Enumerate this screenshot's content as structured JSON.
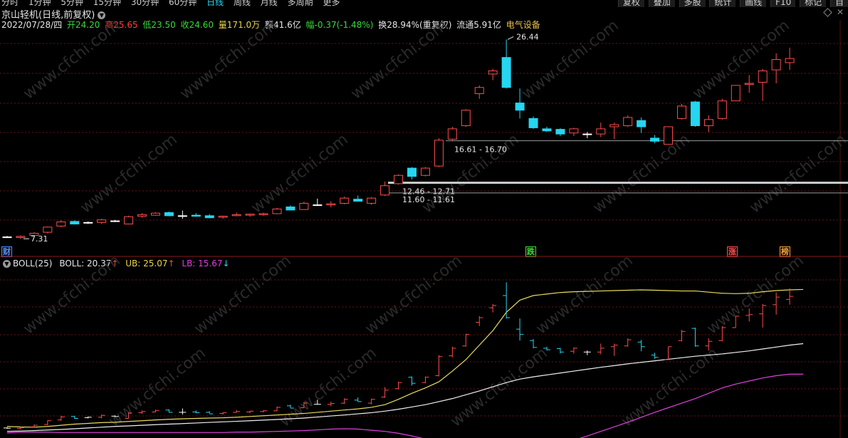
{
  "toolbar": {
    "periods": [
      "分时",
      "1分钟",
      "5分钟",
      "15分钟",
      "30分钟",
      "60分钟",
      "日线",
      "周线",
      "月线",
      "多周期",
      "更多"
    ],
    "active_period": "日线",
    "right_buttons": [
      "复权",
      "叠加",
      "多股",
      "统计",
      "画线",
      "F10",
      "标记",
      "自"
    ]
  },
  "stock": {
    "name": "京山轻机(日线,前复权)"
  },
  "quote": {
    "date": "2022/07/28/四",
    "open": "开24.20",
    "high": "高25.65",
    "low": "低23.50",
    "close": "收24.60",
    "volume": "量171.0万",
    "amount": "额41.6亿",
    "change": "幅-0.37(-1.48%)",
    "turnover": "换28.94%(重复权)",
    "float": "流通5.91亿",
    "sector": "电气设备"
  },
  "boll_panel": {
    "name": "BOLL(25)",
    "mid": "BOLL: 20.37",
    "ub": "UB: 25.07",
    "lb": "LB: 15.67"
  },
  "watermark": "www.cfchi.com",
  "colors": {
    "up": "#ff4b4b",
    "down": "#24d6f0",
    "doji": "#ffffff",
    "ub": "#e8dc5a",
    "mid": "#f0f0f0",
    "lb": "#e040e0",
    "grid": "#6b1010"
  },
  "chart_data": {
    "type": "candlestick",
    "ylim": [
      6.5,
      27.5
    ],
    "candles": [
      {
        "o": 7.35,
        "h": 7.45,
        "l": 7.25,
        "c": 7.32
      },
      {
        "o": 7.3,
        "h": 7.5,
        "l": 7.15,
        "c": 7.4
      },
      {
        "o": 7.5,
        "h": 7.8,
        "l": 7.4,
        "c": 7.7
      },
      {
        "o": 7.8,
        "h": 8.35,
        "l": 7.7,
        "c": 8.3
      },
      {
        "o": 8.4,
        "h": 8.95,
        "l": 8.3,
        "c": 8.8
      },
      {
        "o": 8.85,
        "h": 8.95,
        "l": 8.55,
        "c": 8.6
      },
      {
        "o": 8.7,
        "h": 8.85,
        "l": 8.6,
        "c": 8.75
      },
      {
        "o": 8.75,
        "h": 9.1,
        "l": 8.6,
        "c": 9.0
      },
      {
        "o": 8.9,
        "h": 9.0,
        "l": 8.8,
        "c": 8.85
      },
      {
        "o": 8.6,
        "h": 9.4,
        "l": 8.6,
        "c": 9.3
      },
      {
        "o": 9.35,
        "h": 9.65,
        "l": 9.2,
        "c": 9.5
      },
      {
        "o": 9.45,
        "h": 9.75,
        "l": 9.4,
        "c": 9.65
      },
      {
        "o": 9.7,
        "h": 9.8,
        "l": 9.35,
        "c": 9.4
      },
      {
        "o": 9.4,
        "h": 9.9,
        "l": 9.1,
        "c": 9.4
      },
      {
        "o": 9.45,
        "h": 9.65,
        "l": 9.3,
        "c": 9.35
      },
      {
        "o": 9.4,
        "h": 9.55,
        "l": 9.25,
        "c": 9.2
      },
      {
        "o": 9.25,
        "h": 9.4,
        "l": 9.1,
        "c": 9.35
      },
      {
        "o": 9.4,
        "h": 9.7,
        "l": 9.35,
        "c": 9.5
      },
      {
        "o": 9.45,
        "h": 9.6,
        "l": 9.3,
        "c": 9.55
      },
      {
        "o": 9.5,
        "h": 9.7,
        "l": 9.4,
        "c": 9.6
      },
      {
        "o": 9.6,
        "h": 10.15,
        "l": 9.55,
        "c": 10.05
      },
      {
        "o": 10.25,
        "h": 10.4,
        "l": 9.95,
        "c": 9.95
      },
      {
        "o": 10.0,
        "h": 10.75,
        "l": 9.95,
        "c": 10.6
      },
      {
        "o": 10.45,
        "h": 11.05,
        "l": 10.4,
        "c": 10.45
      },
      {
        "o": 10.45,
        "h": 10.8,
        "l": 10.2,
        "c": 10.55
      },
      {
        "o": 10.6,
        "h": 11.25,
        "l": 10.5,
        "c": 11.1
      },
      {
        "o": 11.0,
        "h": 11.35,
        "l": 10.8,
        "c": 10.8
      },
      {
        "o": 10.6,
        "h": 11.2,
        "l": 10.45,
        "c": 11.1
      },
      {
        "o": 11.4,
        "h": 12.7,
        "l": 11.3,
        "c": 12.3
      },
      {
        "o": 12.5,
        "h": 13.4,
        "l": 12.4,
        "c": 13.3
      },
      {
        "o": 14.0,
        "h": 14.1,
        "l": 12.9,
        "c": 13.2
      },
      {
        "o": 13.3,
        "h": 14.1,
        "l": 13.2,
        "c": 14.0
      },
      {
        "o": 14.2,
        "h": 16.9,
        "l": 14.1,
        "c": 16.7
      },
      {
        "o": 16.8,
        "h": 18.0,
        "l": 16.6,
        "c": 17.8
      },
      {
        "o": 18.1,
        "h": 19.7,
        "l": 18.0,
        "c": 19.6
      },
      {
        "o": 21.2,
        "h": 22.0,
        "l": 20.7,
        "c": 21.8
      },
      {
        "o": 23.1,
        "h": 23.6,
        "l": 22.5,
        "c": 23.4
      },
      {
        "o": 24.7,
        "h": 26.44,
        "l": 21.7,
        "c": 21.8
      },
      {
        "o": 20.3,
        "h": 21.7,
        "l": 18.8,
        "c": 19.6
      },
      {
        "o": 18.8,
        "h": 19.0,
        "l": 17.8,
        "c": 17.9
      },
      {
        "o": 17.8,
        "h": 18.0,
        "l": 17.5,
        "c": 17.6
      },
      {
        "o": 17.75,
        "h": 17.85,
        "l": 17.1,
        "c": 17.3
      },
      {
        "o": 17.4,
        "h": 17.9,
        "l": 17.1,
        "c": 17.8
      },
      {
        "o": 17.3,
        "h": 17.5,
        "l": 16.9,
        "c": 17.3
      },
      {
        "o": 17.3,
        "h": 18.4,
        "l": 17.0,
        "c": 17.8
      },
      {
        "o": 18.0,
        "h": 18.4,
        "l": 16.8,
        "c": 18.2
      },
      {
        "o": 18.1,
        "h": 19.1,
        "l": 18.0,
        "c": 18.9
      },
      {
        "o": 18.6,
        "h": 18.9,
        "l": 17.4,
        "c": 18.0
      },
      {
        "o": 16.9,
        "h": 17.2,
        "l": 16.4,
        "c": 16.6
      },
      {
        "o": 16.3,
        "h": 18.0,
        "l": 16.3,
        "c": 18.0
      },
      {
        "o": 18.8,
        "h": 20.2,
        "l": 18.7,
        "c": 20.0
      },
      {
        "o": 20.4,
        "h": 20.5,
        "l": 18.0,
        "c": 18.1
      },
      {
        "o": 18.1,
        "h": 19.1,
        "l": 17.5,
        "c": 18.7
      },
      {
        "o": 18.8,
        "h": 20.7,
        "l": 18.7,
        "c": 20.5
      },
      {
        "o": 20.5,
        "h": 22.0,
        "l": 20.5,
        "c": 22.0
      },
      {
        "o": 22.1,
        "h": 23.0,
        "l": 21.3,
        "c": 22.2
      },
      {
        "o": 22.3,
        "h": 23.6,
        "l": 20.5,
        "c": 23.4
      },
      {
        "o": 23.5,
        "h": 25.1,
        "l": 22.2,
        "c": 24.5
      },
      {
        "o": 24.2,
        "h": 25.65,
        "l": 23.5,
        "c": 24.6
      }
    ],
    "levels": [
      {
        "label": "16.61 - 16.70",
        "value": 16.65
      },
      {
        "label": "12.46 - 12.71",
        "value": 12.585
      },
      {
        "label": "11.60 - 11.61",
        "value": 11.605
      }
    ],
    "annotations": [
      {
        "text": "26.44",
        "candle": 37,
        "value": 26.44
      },
      {
        "text": "7.31",
        "candle": 1,
        "value": 7.31
      }
    ],
    "boll": {
      "ylim": [
        6.5,
        27.5
      ],
      "ub": [
        7.55,
        7.48,
        7.45,
        7.55,
        7.7,
        7.85,
        7.95,
        8.05,
        8.1,
        8.2,
        8.3,
        8.4,
        8.48,
        8.55,
        8.6,
        8.65,
        8.68,
        8.75,
        8.85,
        8.95,
        9.05,
        9.15,
        9.25,
        9.4,
        9.55,
        9.7,
        9.85,
        10.05,
        10.4,
        11.1,
        11.9,
        12.6,
        13.4,
        14.8,
        16.3,
        18.2,
        20.1,
        22.5,
        24.1,
        24.7,
        24.9,
        25.1,
        25.2,
        25.25,
        25.3,
        25.35,
        25.4,
        25.45,
        25.4,
        25.35,
        25.3,
        25.3,
        25.15,
        25.0,
        24.95,
        25.0,
        25.2,
        25.35,
        25.45,
        25.5
      ],
      "mid": [
        6.9,
        6.95,
        7.0,
        7.08,
        7.15,
        7.25,
        7.35,
        7.45,
        7.55,
        7.62,
        7.7,
        7.78,
        7.85,
        7.92,
        8.0,
        8.08,
        8.15,
        8.22,
        8.3,
        8.38,
        8.46,
        8.55,
        8.65,
        8.78,
        8.92,
        9.05,
        9.2,
        9.35,
        9.55,
        9.8,
        10.1,
        10.4,
        10.8,
        11.2,
        11.7,
        12.2,
        12.75,
        13.3,
        13.75,
        14.05,
        14.3,
        14.55,
        14.8,
        15.05,
        15.3,
        15.52,
        15.75,
        15.95,
        16.15,
        16.35,
        16.55,
        16.75,
        16.9,
        17.05,
        17.25,
        17.45,
        17.7,
        17.95,
        18.2,
        18.4
      ],
      "lb": [
        6.7,
        6.8,
        6.8,
        6.8,
        6.75,
        6.75,
        6.75,
        6.75,
        6.75,
        6.75,
        6.75,
        6.75,
        6.75,
        6.75,
        6.75,
        6.75,
        6.75,
        6.8,
        6.8,
        6.85,
        6.9,
        6.95,
        7.0,
        7.1,
        7.2,
        7.25,
        7.2,
        7.05,
        6.9,
        6.65,
        6.3,
        5.9,
        5.4,
        4.8,
        4.2,
        3.7,
        3.5,
        3.55,
        3.8,
        4.2,
        4.7,
        5.2,
        5.75,
        6.3,
        6.9,
        7.5,
        8.1,
        8.75,
        9.4,
        10.0,
        10.6,
        11.2,
        11.9,
        12.6,
        13.1,
        13.5,
        13.9,
        14.2,
        14.4,
        14.4
      ]
    }
  },
  "tags": [
    {
      "key": "cai",
      "text": "财",
      "color": "#4a90ff"
    },
    {
      "key": "die",
      "text": "跌",
      "color": "#36d93a"
    },
    {
      "key": "zhang",
      "text": "涨",
      "color": "#ff4b4b"
    },
    {
      "key": "bang",
      "text": "榜",
      "color": "#e8a040"
    }
  ]
}
